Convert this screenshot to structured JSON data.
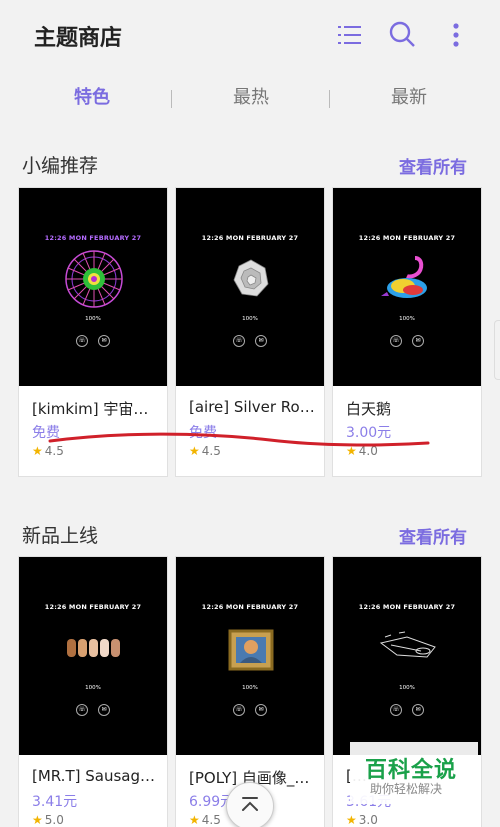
{
  "header": {
    "title": "主题商店",
    "icons": [
      "list-icon",
      "search-icon",
      "more-vertical-icon"
    ]
  },
  "tabs": [
    {
      "label": "特色",
      "active": true
    },
    {
      "label": "最热",
      "active": false
    },
    {
      "label": "最新",
      "active": false
    }
  ],
  "sections": [
    {
      "title": "小编推荐",
      "see_all": "查看所有",
      "cards": [
        {
          "name": "[kimkim] 宇宙…",
          "price": "免费",
          "rating": "4.5",
          "lock_time": "12:26  MON FEBRUARY 27",
          "battery": "100%"
        },
        {
          "name": "[aire] Silver Ro…",
          "price": "免费",
          "rating": "4.5",
          "lock_time": "12:26  MON FEBRUARY 27",
          "battery": "100%"
        },
        {
          "name": "白天鹅",
          "price": "3.00元",
          "rating": "4.0",
          "lock_time": "12:26  MON FEBRUARY 27",
          "battery": "100%"
        }
      ]
    },
    {
      "title": "新品上线",
      "see_all": "查看所有",
      "cards": [
        {
          "name": "[MR.T] Sausag…",
          "price": "3.41元",
          "rating": "5.0",
          "lock_time": "12:26  MON FEBRUARY 27",
          "battery": "100%"
        },
        {
          "name": "[POLY] 自画像_…",
          "price": "6.99元",
          "rating": "4.5",
          "lock_time": "12:26  MON FEBRUARY 27",
          "battery": "100%"
        },
        {
          "name": "[…",
          "price": "3.61元",
          "rating": "3.0",
          "lock_time": "12:26  MON FEBRUARY 27",
          "battery": "100%"
        }
      ]
    }
  ],
  "watermark": {
    "main": "百科全说",
    "sub": "助你轻松解决"
  },
  "colors": {
    "accent": "#7b6ce0",
    "price": "#8b7ee8",
    "star": "#f2b400",
    "annotation": "#d0202a"
  }
}
